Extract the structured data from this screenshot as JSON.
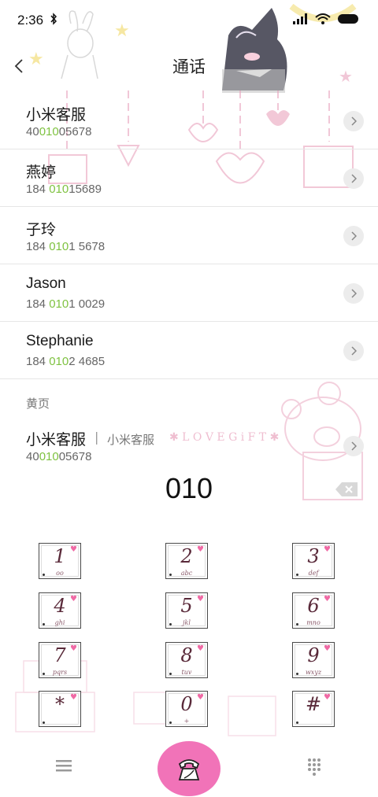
{
  "status": {
    "time": "2:36"
  },
  "header": {
    "title": "通话"
  },
  "contacts": [
    {
      "name": "小米客服",
      "num_pre": "40",
      "num_hl": "010",
      "num_post": "05678"
    },
    {
      "name": "燕婷",
      "num_pre": "184 ",
      "num_hl": "010",
      "num_post": "15689"
    },
    {
      "name": "子玲",
      "num_pre": "184 ",
      "num_hl": "010",
      "num_post": "1 5678"
    },
    {
      "name": "Jason",
      "num_pre": "184 ",
      "num_hl": "010",
      "num_post": "1 0029"
    },
    {
      "name": "Stephanie",
      "num_pre": "184 ",
      "num_hl": "010",
      "num_post": "2 4685"
    }
  ],
  "yellow_pages": {
    "label": "黄页",
    "name": "小米客服",
    "separator": "|",
    "desc": "小米客服",
    "num_pre": "40",
    "num_hl": "010",
    "num_post": "05678"
  },
  "dialer": {
    "dialed": "010"
  },
  "keypad": [
    {
      "digit": "1",
      "letters": "oo"
    },
    {
      "digit": "2",
      "letters": "abc"
    },
    {
      "digit": "3",
      "letters": "def"
    },
    {
      "digit": "4",
      "letters": "ghi"
    },
    {
      "digit": "5",
      "letters": "jkl"
    },
    {
      "digit": "6",
      "letters": "mno"
    },
    {
      "digit": "7",
      "letters": "pqrs"
    },
    {
      "digit": "8",
      "letters": "tuv"
    },
    {
      "digit": "9",
      "letters": "wxyz"
    },
    {
      "digit": "*",
      "letters": ""
    },
    {
      "digit": "0",
      "letters": "+"
    },
    {
      "digit": "#",
      "letters": ""
    }
  ],
  "theme": {
    "decoration_text": "LOVEGIFT",
    "accent": "#f173b8",
    "highlight": "#7fc241",
    "deco_pink": "#e9a3bd"
  }
}
